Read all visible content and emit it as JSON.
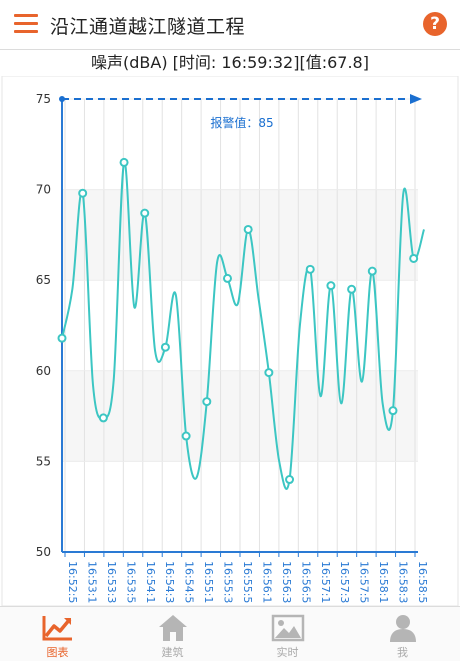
{
  "header": {
    "title": "沿江通道越江隧道工程",
    "help_label": "?"
  },
  "chart": {
    "title": "噪声(dBA) [时间: 16:59:32][值:67.8]"
  },
  "tabs": [
    {
      "label": "图表",
      "icon": "trend-chart-icon",
      "active": true
    },
    {
      "label": "建筑",
      "icon": "home-icon",
      "active": false
    },
    {
      "label": "实时",
      "icon": "picture-icon",
      "active": false
    },
    {
      "label": "我",
      "icon": "user-icon",
      "active": false
    }
  ],
  "colors": {
    "accent": "#e8642c",
    "line": "#3cc6c3",
    "alarm": "#1a6fd0",
    "axis": "#2a7ad4"
  },
  "chart_data": {
    "type": "line",
    "ylim": [
      50,
      75
    ],
    "yticks": [
      50,
      55,
      60,
      65,
      70,
      75
    ],
    "alarm": {
      "value": 85,
      "label": "报警值：85"
    },
    "x": [
      "16:52:5",
      "16:53:1",
      "16:53:3",
      "16:53:5",
      "16:54:1",
      "16:54:3",
      "16:54:5",
      "16:55:1",
      "16:55:3",
      "16:55:5",
      "16:56:1",
      "16:56:3",
      "16:56:5",
      "16:57:1",
      "16:57:3",
      "16:57:5",
      "16:58:1",
      "16:58:3",
      "16:58:5"
    ],
    "series": [
      {
        "values": [
          61.8,
          64.5,
          69.8,
          59.2,
          57.4,
          59.5,
          71.5,
          63.5,
          68.7,
          61.1,
          61.3,
          64.2,
          56.4,
          54.1,
          58.3,
          66.0,
          65.1,
          63.7,
          67.8,
          64.0,
          59.9,
          55.0,
          54.0,
          62.5,
          65.6,
          58.6,
          64.7,
          58.2,
          64.5,
          59.4,
          65.5,
          58.2,
          57.8,
          69.8,
          66.2,
          67.8
        ]
      }
    ]
  }
}
